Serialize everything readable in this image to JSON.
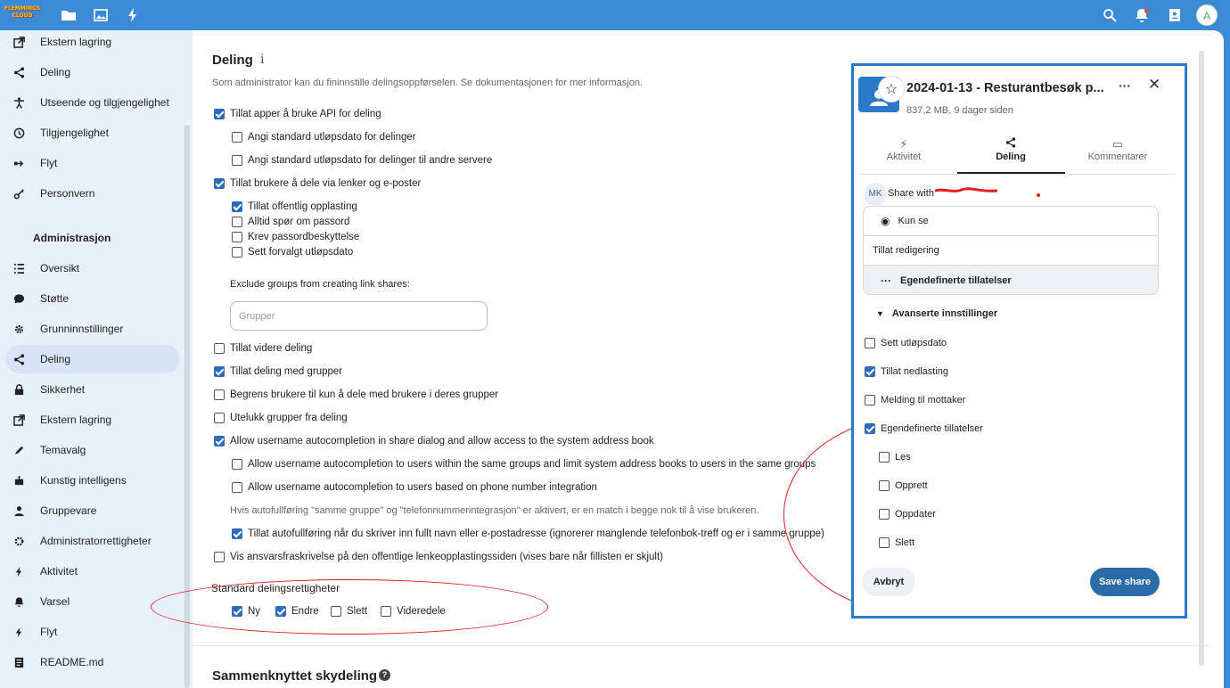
{
  "topbar": {
    "logo_text": "FLEMMINGS CLOUD",
    "icons": [
      "folder-icon",
      "image-icon",
      "lightning-icon",
      "search-icon",
      "bell-icon",
      "contacts-icon"
    ],
    "avatar_letter": "A"
  },
  "sidebar": {
    "items_top": [
      {
        "label": "Ekstern lagring",
        "icon": "external-icon"
      },
      {
        "label": "Deling",
        "icon": "share-icon"
      },
      {
        "label": "Utseende og tilgjengelighet",
        "icon": "accessibility-icon"
      },
      {
        "label": "Tilgjengelighet",
        "icon": "clock-icon"
      },
      {
        "label": "Flyt",
        "icon": "flow-icon"
      },
      {
        "label": "Personvern",
        "icon": "key-icon"
      }
    ],
    "heading": "Administrasjon",
    "items_admin": [
      {
        "label": "Oversikt",
        "icon": "list-icon"
      },
      {
        "label": "Støtte",
        "icon": "chat-icon"
      },
      {
        "label": "Grunninnstillinger",
        "icon": "gear-icon"
      },
      {
        "label": "Deling",
        "icon": "share-icon"
      },
      {
        "label": "Sikkerhet",
        "icon": "lock-icon"
      },
      {
        "label": "Ekstern lagring",
        "icon": "external-icon"
      },
      {
        "label": "Temavalg",
        "icon": "paint-icon"
      },
      {
        "label": "Kunstig intelligens",
        "icon": "robot-icon"
      },
      {
        "label": "Gruppevare",
        "icon": "groupware-icon"
      },
      {
        "label": "Administratorrettigheter",
        "icon": "admin-icon"
      },
      {
        "label": "Aktivitet",
        "icon": "lightning-icon"
      },
      {
        "label": "Varsel",
        "icon": "bell-icon"
      },
      {
        "label": "Flyt",
        "icon": "flow-icon"
      },
      {
        "label": "README.md",
        "icon": "doc-icon"
      }
    ]
  },
  "main": {
    "title": "Deling",
    "info": "i",
    "description": "Som administrator kan du fininnstille delingsoppførselen. Se dokumentasjonen for mer informasjon.",
    "options": [
      {
        "label": "Tillat apper å bruke API for deling",
        "checked": true
      },
      {
        "label": "Angi standard utløpsdato for delinger",
        "checked": false
      },
      {
        "label": "Angi standard utløpsdato for delinger til andre servere",
        "checked": false
      },
      {
        "label": "Tillat brukere å dele via lenker og e-poster",
        "checked": true
      },
      {
        "label": "Tillat offentlig opplasting",
        "checked": true
      },
      {
        "label": "Alltid spør om passord",
        "checked": false
      },
      {
        "label": "Krev passordbeskyttelse",
        "checked": false
      },
      {
        "label": "Sett forvalgt utløpsdato",
        "checked": false
      },
      {
        "label": "Tillat videre deling",
        "checked": false
      },
      {
        "label": "Tillat deling med grupper",
        "checked": true
      },
      {
        "label": "Begrens brukere til kun å dele med brukere i deres grupper",
        "checked": false
      },
      {
        "label": "Utelukk grupper fra deling",
        "checked": false
      },
      {
        "label": "Allow username autocompletion in share dialog and allow access to the system address book",
        "checked": true
      },
      {
        "label": "Allow username autocompletion to users within the same groups and limit system address books to users in the same groups",
        "checked": false
      },
      {
        "label": "Allow username autocompletion to users based on phone number integration",
        "checked": false
      },
      {
        "label": "Tillat autofullføring når du skriver inn fullt navn eller e-postadresse (ignorerer manglende telefonbok-treff og er i samme gruppe)",
        "checked": true
      },
      {
        "label": "Vis ansvarsfraskrivelse på den offentlige lenkeopplastingssiden (vises bare når fillisten er skjult)",
        "checked": false
      }
    ],
    "exclude_groups_label": "Exclude groups from creating link shares:",
    "groups_placeholder": "Grupper",
    "autocomplete_hint": "Hvis autofullføring \"samme gruppe\" og \"telefonnummerintegrasjon\" er aktivert, er en match i begge nok til å vise brukeren.",
    "default_permissions_label": "Standard delingsrettigheter",
    "default_permissions": [
      {
        "label": "Ny",
        "checked": true
      },
      {
        "label": "Endre",
        "checked": true
      },
      {
        "label": "Slett",
        "checked": false
      },
      {
        "label": "Videredele",
        "checked": false
      }
    ],
    "federated_title": "Sammenknyttet skydeling",
    "federated_help": "?"
  },
  "share_panel": {
    "file_title": "2024-01-13 - Resturantbesøk p...",
    "file_meta": "837,2 MB, 9 dager siden",
    "more": "···",
    "close": "✕",
    "tabs": [
      {
        "label": "Aktivitet",
        "icon": "lightning-icon"
      },
      {
        "label": "Deling",
        "icon": "share-icon"
      },
      {
        "label": "Kommentarer",
        "icon": "comment-icon"
      }
    ],
    "avatar_initials": "MK",
    "share_with": "Share with",
    "permission_options": [
      {
        "label": "Kun se",
        "icon": "eye-icon"
      },
      {
        "label": "Tillat redigering",
        "icon": ""
      },
      {
        "label": "Egendefinerte tillatelser",
        "icon": "dots-icon"
      }
    ],
    "advanced_label": "Avanserte innstillinger",
    "advanced_options": [
      {
        "label": "Sett utløpsdato",
        "checked": false
      },
      {
        "label": "Tillat nedlasting",
        "checked": true
      },
      {
        "label": "Melding til mottaker",
        "checked": false
      },
      {
        "label": "Egendefinerte tillatelser",
        "checked": true
      }
    ],
    "custom_permissions": [
      {
        "label": "Les",
        "checked": false
      },
      {
        "label": "Opprett",
        "checked": false
      },
      {
        "label": "Oppdater",
        "checked": false
      },
      {
        "label": "Slett",
        "checked": false
      }
    ],
    "cancel_label": "Avbryt",
    "save_label": "Save share"
  },
  "colors": {
    "accent": "#2b6bb8",
    "topbar": "#3b8ad6",
    "annotation": "#e02020"
  }
}
